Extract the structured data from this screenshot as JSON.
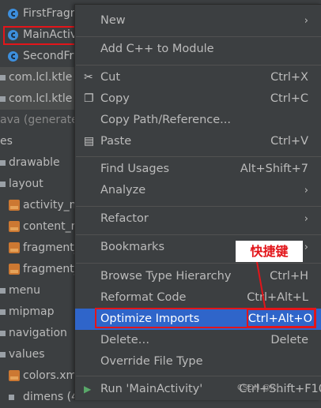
{
  "tree": {
    "items": [
      {
        "label": "FirstFragm",
        "icon": "class-icon"
      },
      {
        "label": "MainActivi",
        "icon": "class-icon"
      },
      {
        "label": "SecondFra",
        "icon": "class-icon"
      },
      {
        "label": "com.lcl.ktle",
        "icon": "package-icon"
      },
      {
        "label": "com.lcl.ktle",
        "icon": "package-icon"
      },
      {
        "label": "ava (generated",
        "icon": ""
      },
      {
        "label": "es",
        "icon": ""
      },
      {
        "label": "drawable",
        "icon": "folder-icon"
      },
      {
        "label": "layout",
        "icon": "folder-icon"
      },
      {
        "label": "activity_m",
        "icon": "xml-file-icon"
      },
      {
        "label": "content_m",
        "icon": "xml-file-icon"
      },
      {
        "label": "fragment_",
        "icon": "xml-file-icon"
      },
      {
        "label": "fragment_",
        "icon": "xml-file-icon"
      },
      {
        "label": "menu",
        "icon": "folder-icon"
      },
      {
        "label": "mipmap",
        "icon": "folder-icon"
      },
      {
        "label": "navigation",
        "icon": "folder-icon"
      },
      {
        "label": "values",
        "icon": "folder-icon"
      },
      {
        "label": "colors.xm",
        "icon": "xml-file-icon"
      },
      {
        "label": "dimens (4",
        "icon": "folder-icon"
      }
    ]
  },
  "menu": {
    "items": [
      {
        "label": "New",
        "shortcut": "",
        "submenu": true
      },
      {
        "label": "Add C++ to Module",
        "shortcut": "",
        "submenu": false
      },
      {
        "label": "Cut",
        "shortcut": "Ctrl+X",
        "icon": "cut-icon"
      },
      {
        "label": "Copy",
        "shortcut": "Ctrl+C",
        "icon": "copy-icon"
      },
      {
        "label": "Copy Path/Reference...",
        "shortcut": ""
      },
      {
        "label": "Paste",
        "shortcut": "Ctrl+V",
        "icon": "paste-icon"
      },
      {
        "label": "Find Usages",
        "shortcut": "Alt+Shift+7"
      },
      {
        "label": "Analyze",
        "shortcut": "",
        "submenu": true
      },
      {
        "label": "Refactor",
        "shortcut": "",
        "submenu": true
      },
      {
        "label": "Bookmarks",
        "shortcut": "",
        "submenu": true
      },
      {
        "label": "Browse Type Hierarchy",
        "shortcut": "Ctrl+H"
      },
      {
        "label": "Reformat Code",
        "shortcut": "Ctrl+Alt+L"
      },
      {
        "label": "Optimize Imports",
        "shortcut": "Ctrl+Alt+O",
        "selected": true
      },
      {
        "label": "Delete…",
        "shortcut": "Delete"
      },
      {
        "label": "Override File Type",
        "shortcut": ""
      },
      {
        "label": "Run 'MainActivity'",
        "shortcut": "Ctrl+Shift+F10",
        "icon": "run-icon"
      }
    ],
    "arrow": "›"
  },
  "annotation": {
    "label": "快捷键"
  },
  "watermark": "CSDN @lcl_"
}
